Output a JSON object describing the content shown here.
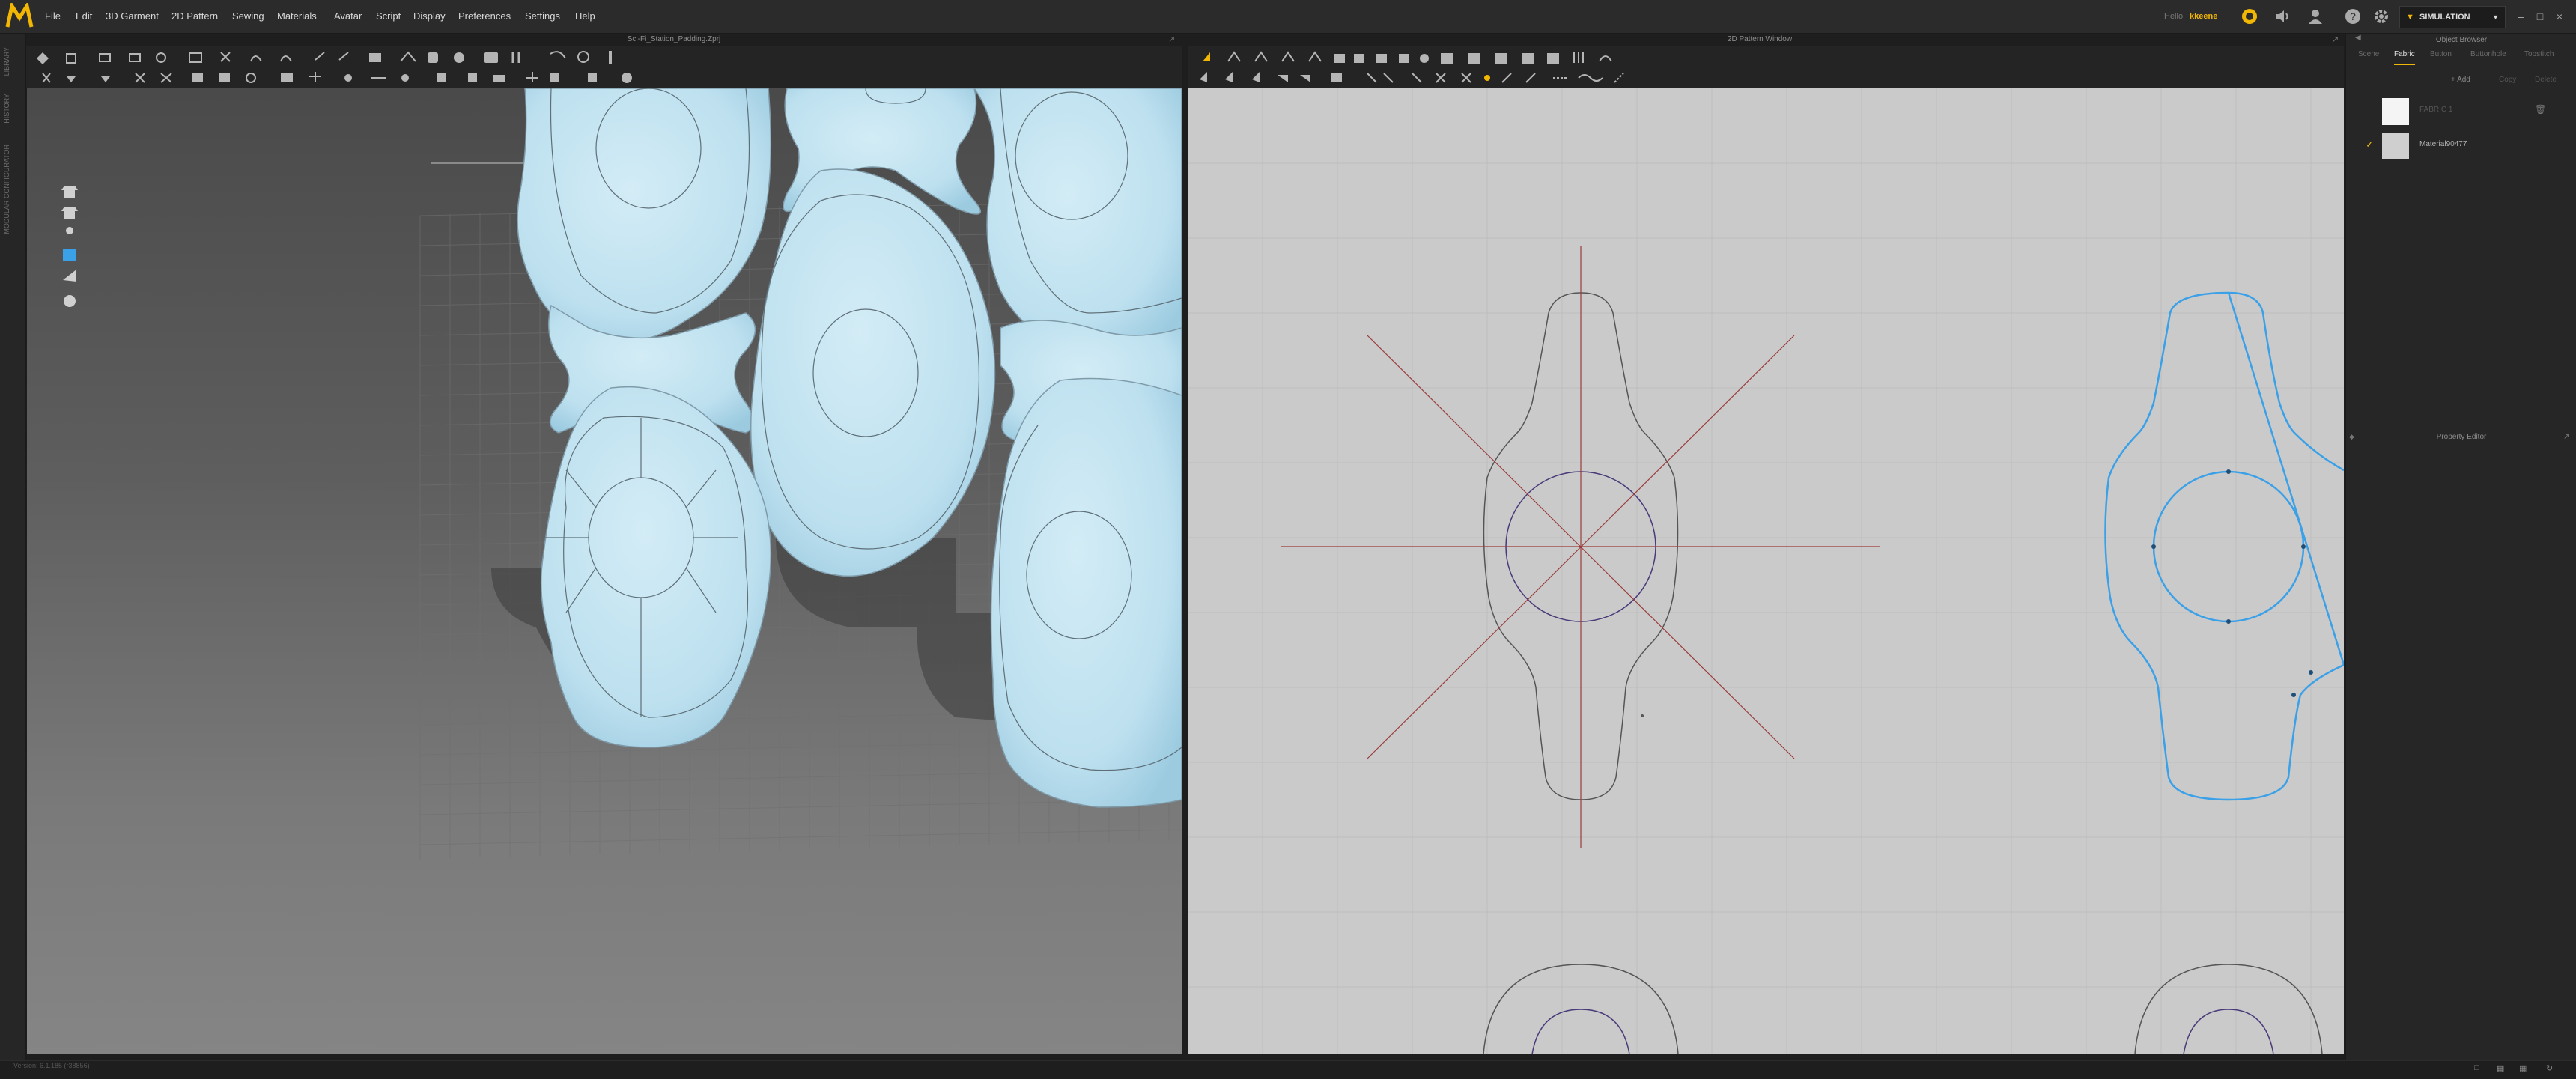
{
  "app": {
    "title": "Sci-Fi_Station_Padding.Zprj",
    "menu": [
      "File",
      "Edit",
      "3D Garment",
      "2D Pattern",
      "Sewing",
      "Materials",
      "Avatar",
      "Script",
      "Display",
      "Preferences",
      "Settings",
      "Help"
    ],
    "hello_prefix": "Hello",
    "user_name": "kkeene",
    "mode_label": "SIMULATION",
    "accent": "#f2b705"
  },
  "left_strip": {
    "tabs": [
      "LIBRARY",
      "HISTORY",
      "MODULAR CONFIGURATOR"
    ]
  },
  "viewport_3d": {
    "title": "Sci-Fi_Station_Padding.Zprj",
    "side_tools": [
      "garment-icon",
      "garment-alt-icon",
      "avatar-icon",
      "shield-icon",
      "brush-icon",
      "avatar-head-icon"
    ]
  },
  "viewport_2d": {
    "title": "2D Pattern Window",
    "selection_color": "#3aa0e8"
  },
  "right_panel": {
    "object_browser_title": "Object Browser",
    "tabs": [
      "Scene",
      "Fabric",
      "Button",
      "Buttonhole",
      "Topstitch"
    ],
    "active_tab": "Fabric",
    "add_label": "+ Add",
    "copy_label": "Copy",
    "delete_label": "Delete",
    "materials": [
      {
        "name": "FABRIC 1",
        "dimmed": true
      },
      {
        "name": "Material90477",
        "dimmed": false,
        "checked": true
      }
    ],
    "property_editor_title": "Property Editor"
  },
  "status": {
    "text": "Version: 6.1.185 (r38856)"
  }
}
